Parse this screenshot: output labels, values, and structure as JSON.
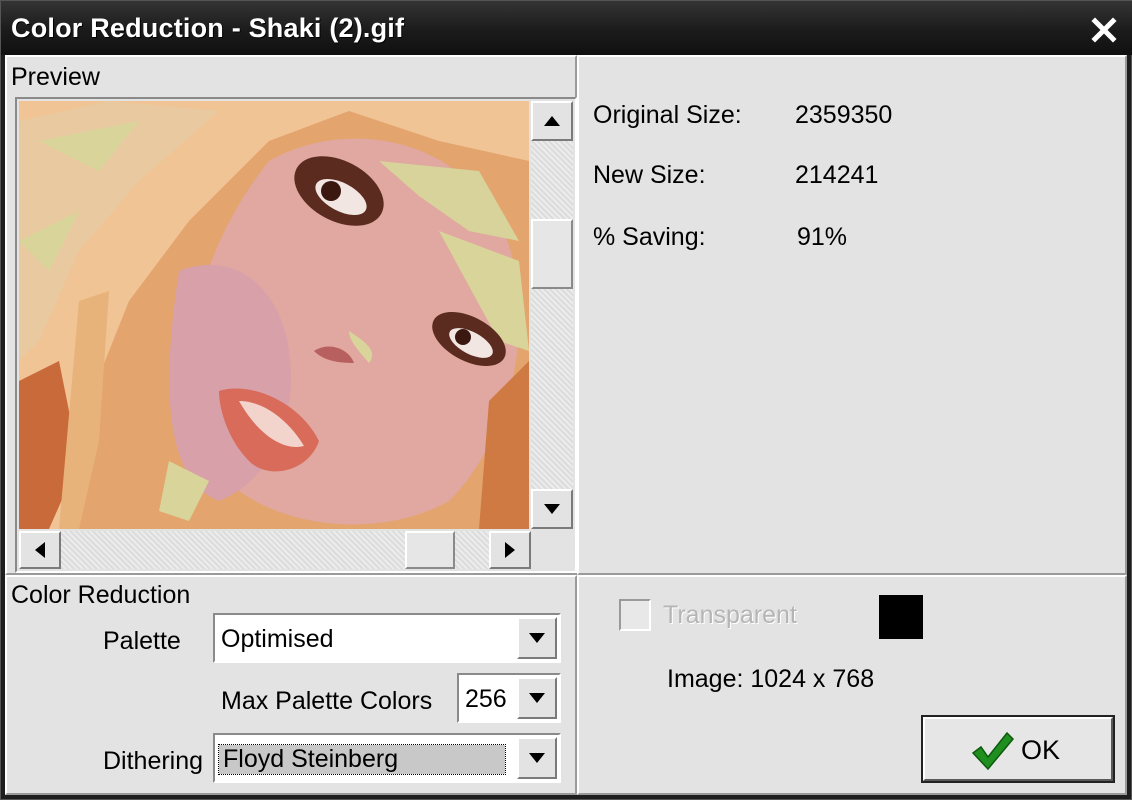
{
  "window": {
    "title": "Color Reduction - Shaki (2).gif"
  },
  "preview": {
    "label": "Preview"
  },
  "stats": {
    "original_size_label": "Original Size:",
    "original_size_value": "2359350",
    "new_size_label": "New Size:",
    "new_size_value": "214241",
    "saving_label": "% Saving:",
    "saving_value": "91%"
  },
  "color_reduction": {
    "label": "Color Reduction",
    "palette_label": "Palette",
    "palette_value": "Optimised",
    "max_colors_label": "Max Palette Colors",
    "max_colors_value": "256",
    "dithering_label": "Dithering",
    "dithering_value": "Floyd Steinberg"
  },
  "options": {
    "transparent_label": "Transparent",
    "transparent_checked": false,
    "transparent_color": "#000000",
    "image_info": "Image: 1024 x 768"
  },
  "buttons": {
    "ok_label": "OK"
  },
  "colors": {
    "accent_check": "#1f8f1f",
    "dialog_bg": "#e3e3e3",
    "title_bg": "#1b1b1b"
  }
}
